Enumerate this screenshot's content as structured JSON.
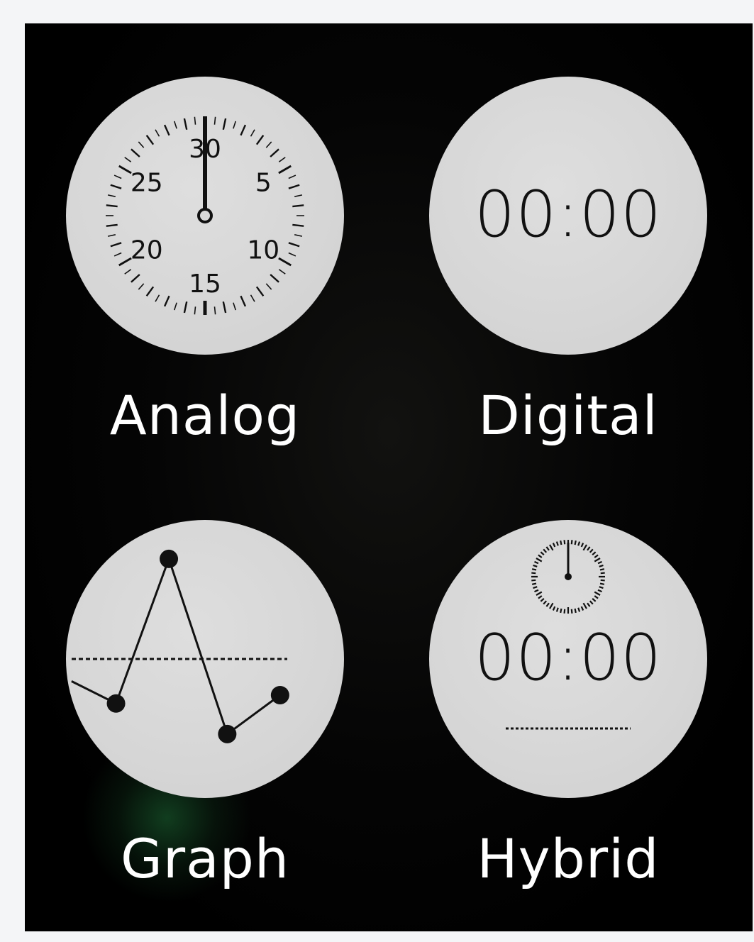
{
  "stopwatch_options": [
    {
      "id": "analog",
      "label": "Analog"
    },
    {
      "id": "digital",
      "label": "Digital",
      "time": "00:00"
    },
    {
      "id": "graph",
      "label": "Graph"
    },
    {
      "id": "hybrid",
      "label": "Hybrid",
      "time": "00:00"
    }
  ],
  "analog_dial": {
    "numbers": [
      "30",
      "5",
      "10",
      "15",
      "20",
      "25"
    ],
    "hand_value": 30
  },
  "graph_dial": {
    "points": [
      [
        0.18,
        0.66
      ],
      [
        0.37,
        0.14
      ],
      [
        0.58,
        0.77
      ],
      [
        0.77,
        0.63
      ]
    ],
    "lead_in": [
      0.02,
      0.58
    ]
  },
  "colors": {
    "background": "#000000",
    "dial": "#d6d6d6",
    "ink": "#111111",
    "label": "#ffffff",
    "glow": "#1e6e37"
  }
}
